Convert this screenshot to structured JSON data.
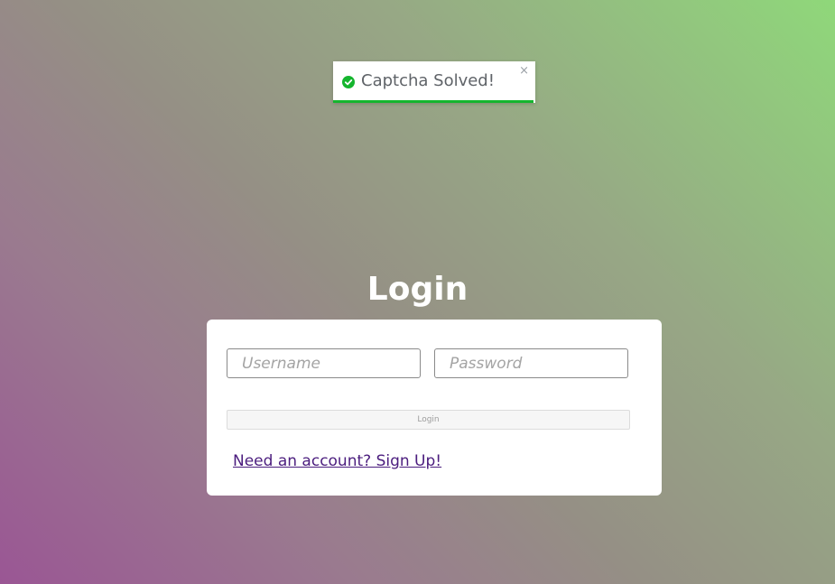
{
  "toast": {
    "message": "Captcha Solved!",
    "close_glyph": "×",
    "icon": "check-circle-icon",
    "progress": 0.99,
    "accent_color": "#15b52e"
  },
  "login": {
    "title": "Login",
    "username_placeholder": "Username",
    "password_placeholder": "Password",
    "submit_label": "Login",
    "signup_link": "Need an account? Sign Up!"
  },
  "colors": {
    "background_gradient": [
      "#8fd87a",
      "#958f85",
      "#9a5694"
    ],
    "link": "#4b1d7e"
  }
}
